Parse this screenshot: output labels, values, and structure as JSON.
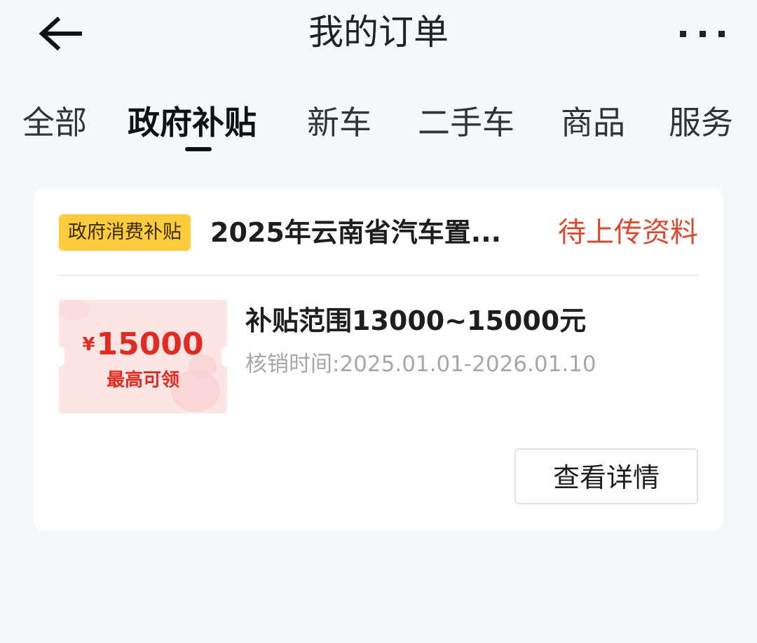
{
  "header": {
    "title": "我的订单",
    "back_icon": "arrow-left-icon",
    "more_icon": "more-dots-icon"
  },
  "tabs": [
    {
      "label": "全部",
      "active": false
    },
    {
      "label": "政府补贴",
      "active": true
    },
    {
      "label": "新车",
      "active": false
    },
    {
      "label": "二手车",
      "active": false
    },
    {
      "label": "商品",
      "active": false
    },
    {
      "label": "服务",
      "active": false
    }
  ],
  "order": {
    "tag": "政府消费补贴",
    "title": "2025年云南省汽车置...",
    "status": "待上传资料",
    "coupon": {
      "currency": "¥",
      "amount": "15000",
      "caption": "最高可领"
    },
    "range": "补贴范围13000~15000元",
    "time": "核销时间:2025.01.01-2026.01.10",
    "detail_button": "查看详情"
  },
  "colors": {
    "background": "#f6f7fb",
    "tag_bg": "#ffcd3c",
    "status": "#d84a2e",
    "coupon_bg": "#fde5e4",
    "coupon_text": "#e02a22",
    "muted_text": "#a6a6ab"
  }
}
